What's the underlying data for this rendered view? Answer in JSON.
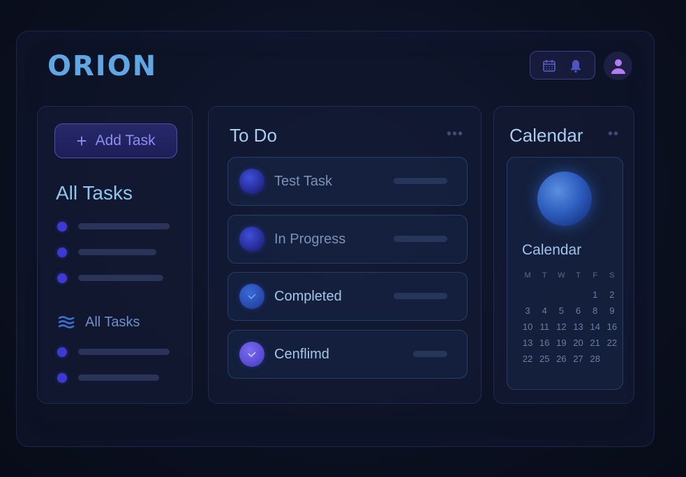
{
  "app": {
    "title": "ORION"
  },
  "header": {
    "icons": [
      {
        "name": "calendar-icon"
      },
      {
        "name": "bell-icon"
      }
    ],
    "avatar_icon": "user-icon"
  },
  "sidebar": {
    "add_button_label": "Add Task",
    "add_button_icon": "plus-icon",
    "title": "All Tasks",
    "sub_heading": "All Tasks",
    "sub_heading_icon": "list-icon"
  },
  "todo": {
    "title": "To Do",
    "tasks": [
      {
        "label": "Test Task",
        "icon": "orb-icon"
      },
      {
        "label": "In Progress",
        "icon": "orb-icon"
      },
      {
        "label": "Completed",
        "icon": "check-icon"
      },
      {
        "label": "Cenflimd",
        "icon": "check-icon"
      }
    ]
  },
  "calendar": {
    "title": "Calendar",
    "card_label": "Calendar",
    "weekdays": [
      "M",
      "T",
      "W",
      "T",
      "F",
      "S"
    ],
    "rows": [
      [
        "",
        "",
        "",
        "",
        "1",
        "2"
      ],
      [
        "3",
        "4",
        "5",
        "6",
        "8",
        "9"
      ],
      [
        "10",
        "11",
        "12",
        "13",
        "14",
        "16"
      ],
      [
        "13",
        "16",
        "19",
        "20",
        "21",
        "22"
      ],
      [
        "22",
        "25",
        "26",
        "27",
        "28",
        ""
      ]
    ]
  },
  "colors": {
    "accent": "#5fa6e3",
    "dot": "#3c3ad0",
    "button": "#26286a"
  }
}
